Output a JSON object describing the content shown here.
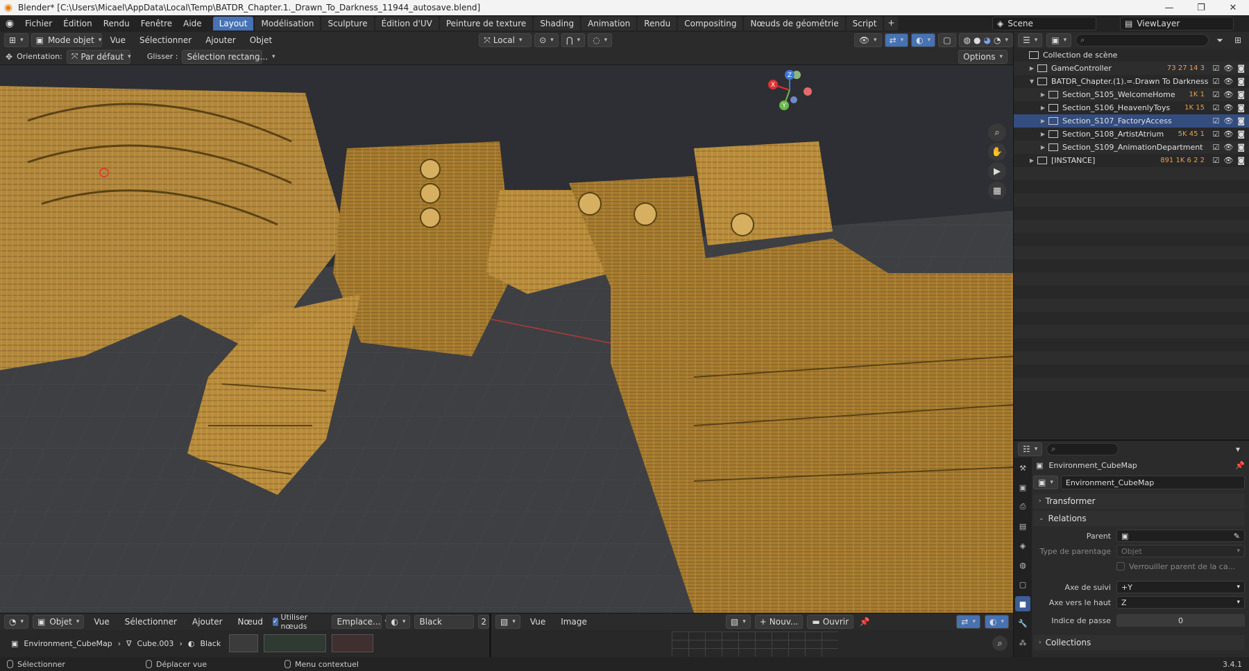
{
  "window": {
    "title": "Blender* [C:\\Users\\Micael\\AppData\\Local\\Temp\\BATDR_Chapter.1._Drawn_To_Darkness_11944_autosave.blend]"
  },
  "menu": [
    "Fichier",
    "Édition",
    "Rendu",
    "Fenêtre",
    "Aide"
  ],
  "workspaces": [
    "Layout",
    "Modélisation",
    "Sculpture",
    "Édition d'UV",
    "Peinture de texture",
    "Shading",
    "Animation",
    "Rendu",
    "Compositing",
    "Nœuds de géométrie",
    "Script"
  ],
  "active_workspace": "Layout",
  "scene": {
    "name": "Scene",
    "view_layer": "ViewLayer"
  },
  "viewport_header": {
    "mode": "Mode objet",
    "menus": [
      "Vue",
      "Sélectionner",
      "Ajouter",
      "Objet"
    ],
    "transform_orientation": "Local"
  },
  "tool_settings": {
    "orientation_label": "Orientation:",
    "orientation_value": "Par défaut",
    "drag_label": "Glisser :",
    "drag_value": "Sélection rectang...",
    "options_label": "Options"
  },
  "gizmo": {
    "x": "X",
    "y": "Y",
    "z": "Z"
  },
  "outliner": {
    "root": "Collection de scène",
    "rows": [
      {
        "name": "GameController",
        "badges": "73 27 14 3",
        "indent": 1
      },
      {
        "name": "BATDR_Chapter.(1).=.Drawn To Darkness",
        "badges": "",
        "indent": 1,
        "expanded": true
      },
      {
        "name": "Section_S105_WelcomeHome",
        "badges": "1K 1",
        "indent": 2
      },
      {
        "name": "Section_S106_HeavenlyToys",
        "badges": "1K 15",
        "indent": 2
      },
      {
        "name": "Section_S107_FactoryAccess",
        "badges": "",
        "indent": 2,
        "selected": true
      },
      {
        "name": "Section_S108_ArtistAtrium",
        "badges": "5K 45 1",
        "indent": 2
      },
      {
        "name": "Section_S109_AnimationDepartment",
        "badges": "",
        "indent": 2
      },
      {
        "name": "[INSTANCE]",
        "badges": "891 1K 6 2 2",
        "indent": 1
      }
    ]
  },
  "properties": {
    "object_name": "Environment_CubeMap",
    "datablock_name": "Environment_CubeMap",
    "panels": {
      "transform": "Transformer",
      "relations": "Relations",
      "collections": "Collections"
    },
    "fields": {
      "parent_label": "Parent",
      "parent_value": "",
      "parent_type_label": "Type de parentage",
      "parent_type_value": "Objet",
      "lock_parent_label": "Verrouiller parent de la ca...",
      "track_axis_label": "Axe de suivi",
      "track_axis_value": "+Y",
      "up_axis_label": "Axe vers le haut",
      "up_axis_value": "Z",
      "pass_index_label": "Indice de passe",
      "pass_index_value": "0"
    }
  },
  "node_editor": {
    "type": "Objet",
    "menus": [
      "Vue",
      "Sélectionner",
      "Ajouter",
      "Nœud"
    ],
    "use_nodes_label": "Utiliser nœuds",
    "slot": "Emplace...",
    "material": "Black",
    "user_count": "2",
    "breadcrumb": [
      "Environment_CubeMap",
      "Cube.003",
      "Black"
    ]
  },
  "image_editor": {
    "menus": [
      "Vue",
      "Image"
    ],
    "new_label": "Nouv...",
    "open_label": "Ouvrir"
  },
  "statusbar": {
    "items": [
      "Sélectionner",
      "Déplacer vue",
      "Menu contextuel"
    ],
    "version": "3.4.1"
  },
  "colors": {
    "accent": "#4772b3",
    "selection": "#334d80",
    "model_gold": "#b98c3c",
    "background": "#161616"
  }
}
